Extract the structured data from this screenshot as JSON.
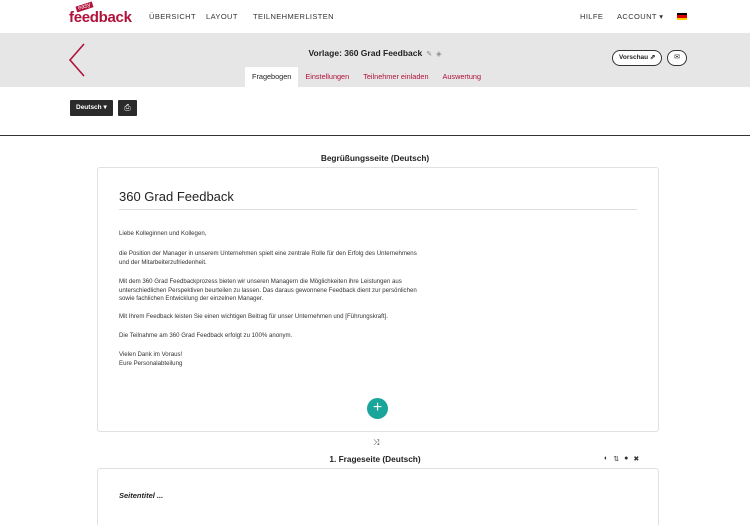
{
  "logo": {
    "badge": "easy",
    "text": "feedback"
  },
  "nav": {
    "uebersicht": "ÜBERSICHT",
    "layout": "LAYOUT",
    "teilnehmerlisten": "TEILNEHMERLISTEN",
    "hilfe": "HILFE",
    "account": "ACCOUNT ▾"
  },
  "header": {
    "title": "Vorlage: 360 Grad Feedback",
    "edit_icon": "✎",
    "tag_icon": "◈",
    "preview_label": "Vorschau ⇗",
    "mail_icon": "✉"
  },
  "tabs": [
    "Fragebogen",
    "Einstellungen",
    "Teilnehmer einladen",
    "Auswertung"
  ],
  "toolbar": {
    "language": "Deutsch ▾",
    "print_icon": "⎙"
  },
  "welcome": {
    "section_title": "Begrüßungsseite (Deutsch)",
    "heading": "360 Grad Feedback",
    "paragraphs": [
      "Liebe Kolleginnen und Kollegen,",
      "die Position der Manager in unserem Unternehmen spielt eine zentrale Rolle für den Erfolg des Unternehmens",
      "und der Mitarbeiterzufriedenheit.",
      "Mit dem 360 Grad Feedbackprozess bieten wir unseren Managern die Möglichkeiten ihre Leistungen aus",
      "unterschiedlichen Perspektiven beurteilen zu lassen. Das daraus gewonnene Feedback dient zur persönlichen",
      "sowie fachlichen Entwicklung der einzelnen Manager.",
      "Mit Ihrem Feedback leisten Sie einen wichtigen Beitrag für unser Unternehmen und [Führungskraft].",
      "Die Teilnahme am 360 Grad Feedback erfolgt zu 100% anonym.",
      "Vielen Dank im Voraus!",
      "Eure Personalabteilung"
    ],
    "add_icon": "+"
  },
  "shuffle_icon": "⤨",
  "question_page": {
    "section_title": "1. Frageseite (Deutsch)",
    "tools": [
      "◐",
      "⇅",
      "●",
      "✖"
    ],
    "page_title_placeholder": "Seitentitel ..."
  },
  "colors": {
    "brand": "#b0123a",
    "accent": "#1aa59a",
    "header_bg": "#e6e6e6",
    "dark_button": "#2b2b2b"
  }
}
